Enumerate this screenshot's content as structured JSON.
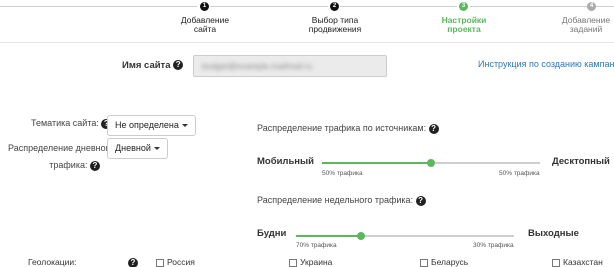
{
  "steps": [
    {
      "number": "1",
      "label_line1": "Добавление",
      "label_line2": "сайта",
      "state": "done",
      "color": "#111111"
    },
    {
      "number": "2",
      "label_line1": "Выбор типа",
      "label_line2": "продвижения",
      "state": "done",
      "color": "#111111"
    },
    {
      "number": "3",
      "label_line1": "Настройки",
      "label_line2": "проекта",
      "state": "active",
      "color": "#5cb85c"
    },
    {
      "number": "4",
      "label_line1": "Добавление",
      "label_line2": "заданий",
      "state": "pending",
      "color": "#aaaaaa"
    }
  ],
  "site_name": {
    "label": "Имя сайта",
    "hint_icon": "question-circle-icon",
    "value": "budget@example.mailmail.ru"
  },
  "instruction_link": "Инструкция по созданию кампании в",
  "theme": {
    "label": "Тематика сайта:",
    "value": "Не определена"
  },
  "daily_distribution": {
    "label_line1": "Распределение дневного",
    "label_line2": "трафика:",
    "value": "Дневной"
  },
  "source_distribution": {
    "title": "Распределение трафика по источникам:",
    "left_label": "Мобильный",
    "right_label": "Десктопный",
    "left_caption": "50% трафика",
    "right_caption": "50% трафика",
    "value_percent": 50
  },
  "weekly_distribution": {
    "title": "Распределение недельного трафика:",
    "left_label": "Будни",
    "right_label": "Выходные",
    "left_caption": "70% трафика",
    "right_caption": "30% трафика",
    "value_percent": 30
  },
  "geo": {
    "label": "Геолокации:",
    "options": [
      {
        "label": "Россия",
        "checked": false
      },
      {
        "label": "Украина",
        "checked": false
      },
      {
        "label": "Беларусь",
        "checked": false
      },
      {
        "label": "Казахстан",
        "checked": false
      }
    ]
  },
  "colors": {
    "accent": "#5cb85c",
    "link": "#2a7ab8"
  }
}
